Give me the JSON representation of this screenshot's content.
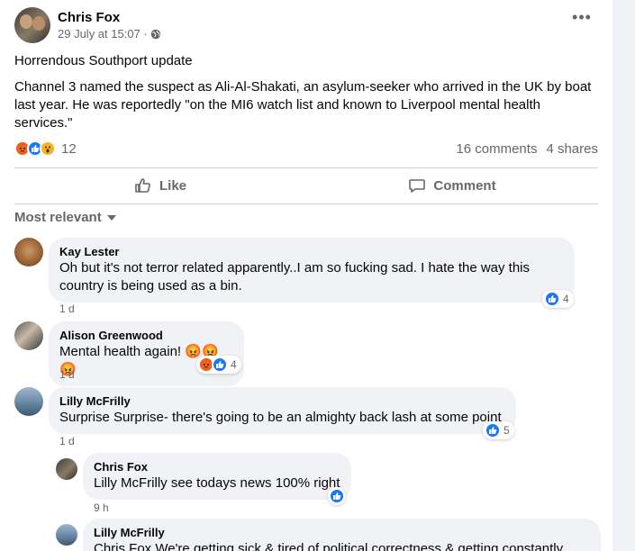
{
  "post": {
    "author": "Chris Fox",
    "timestamp": "29 July at 15:07 ·",
    "paragraphs": [
      "Horrendous Southport update",
      "Channel 3 named the suspect as Ali-Al-Shakati, an asylum-seeker who arrived in the UK by boat last year. He was reportedly \"on the MI6 watch list and known to Liverpool mental health services.\""
    ],
    "reaction_count": "12",
    "reactions": [
      "angry",
      "like",
      "wow"
    ],
    "comments_count": "16 comments",
    "shares_count": "4 shares",
    "more_icon": "•••"
  },
  "actions": {
    "like": "Like",
    "comment": "Comment"
  },
  "sort": {
    "label": "Most relevant"
  },
  "comments": [
    {
      "name": "Kay Lester",
      "text": "Oh but it's not terror related apparently..I am so fucking sad. I hate the way this country is being used as a bin.",
      "time": "1 d",
      "reactions": [
        "like"
      ],
      "reaction_count": "4"
    },
    {
      "name": "Alison Greenwood",
      "text": "Mental health again! 😡😡😡",
      "time": "1 d",
      "reactions": [
        "angry",
        "like"
      ],
      "reaction_count": "4"
    },
    {
      "name": "Lilly McFrilly",
      "text": "Surprise Surprise- there's going to be an almighty back lash at some point",
      "time": "1 d",
      "reactions": [
        "like"
      ],
      "reaction_count": "5"
    },
    {
      "name": "Chris Fox",
      "text": "Lilly McFrilly see todays news 100% right",
      "time": "9 h",
      "reactions": [
        "like"
      ],
      "reaction_count": ""
    },
    {
      "name": "Lilly McFrilly",
      "text": "Chris Fox We're getting sick & tired of political correctness & getting constantly",
      "time": "",
      "reactions": [],
      "reaction_count": ""
    }
  ],
  "colors": {
    "brand_blue": "#1877f2",
    "angry_orange": "#f15a24",
    "wow_yellow": "#f7b125",
    "secondary_text": "#65676b",
    "bubble_bg": "#f0f2f5"
  }
}
